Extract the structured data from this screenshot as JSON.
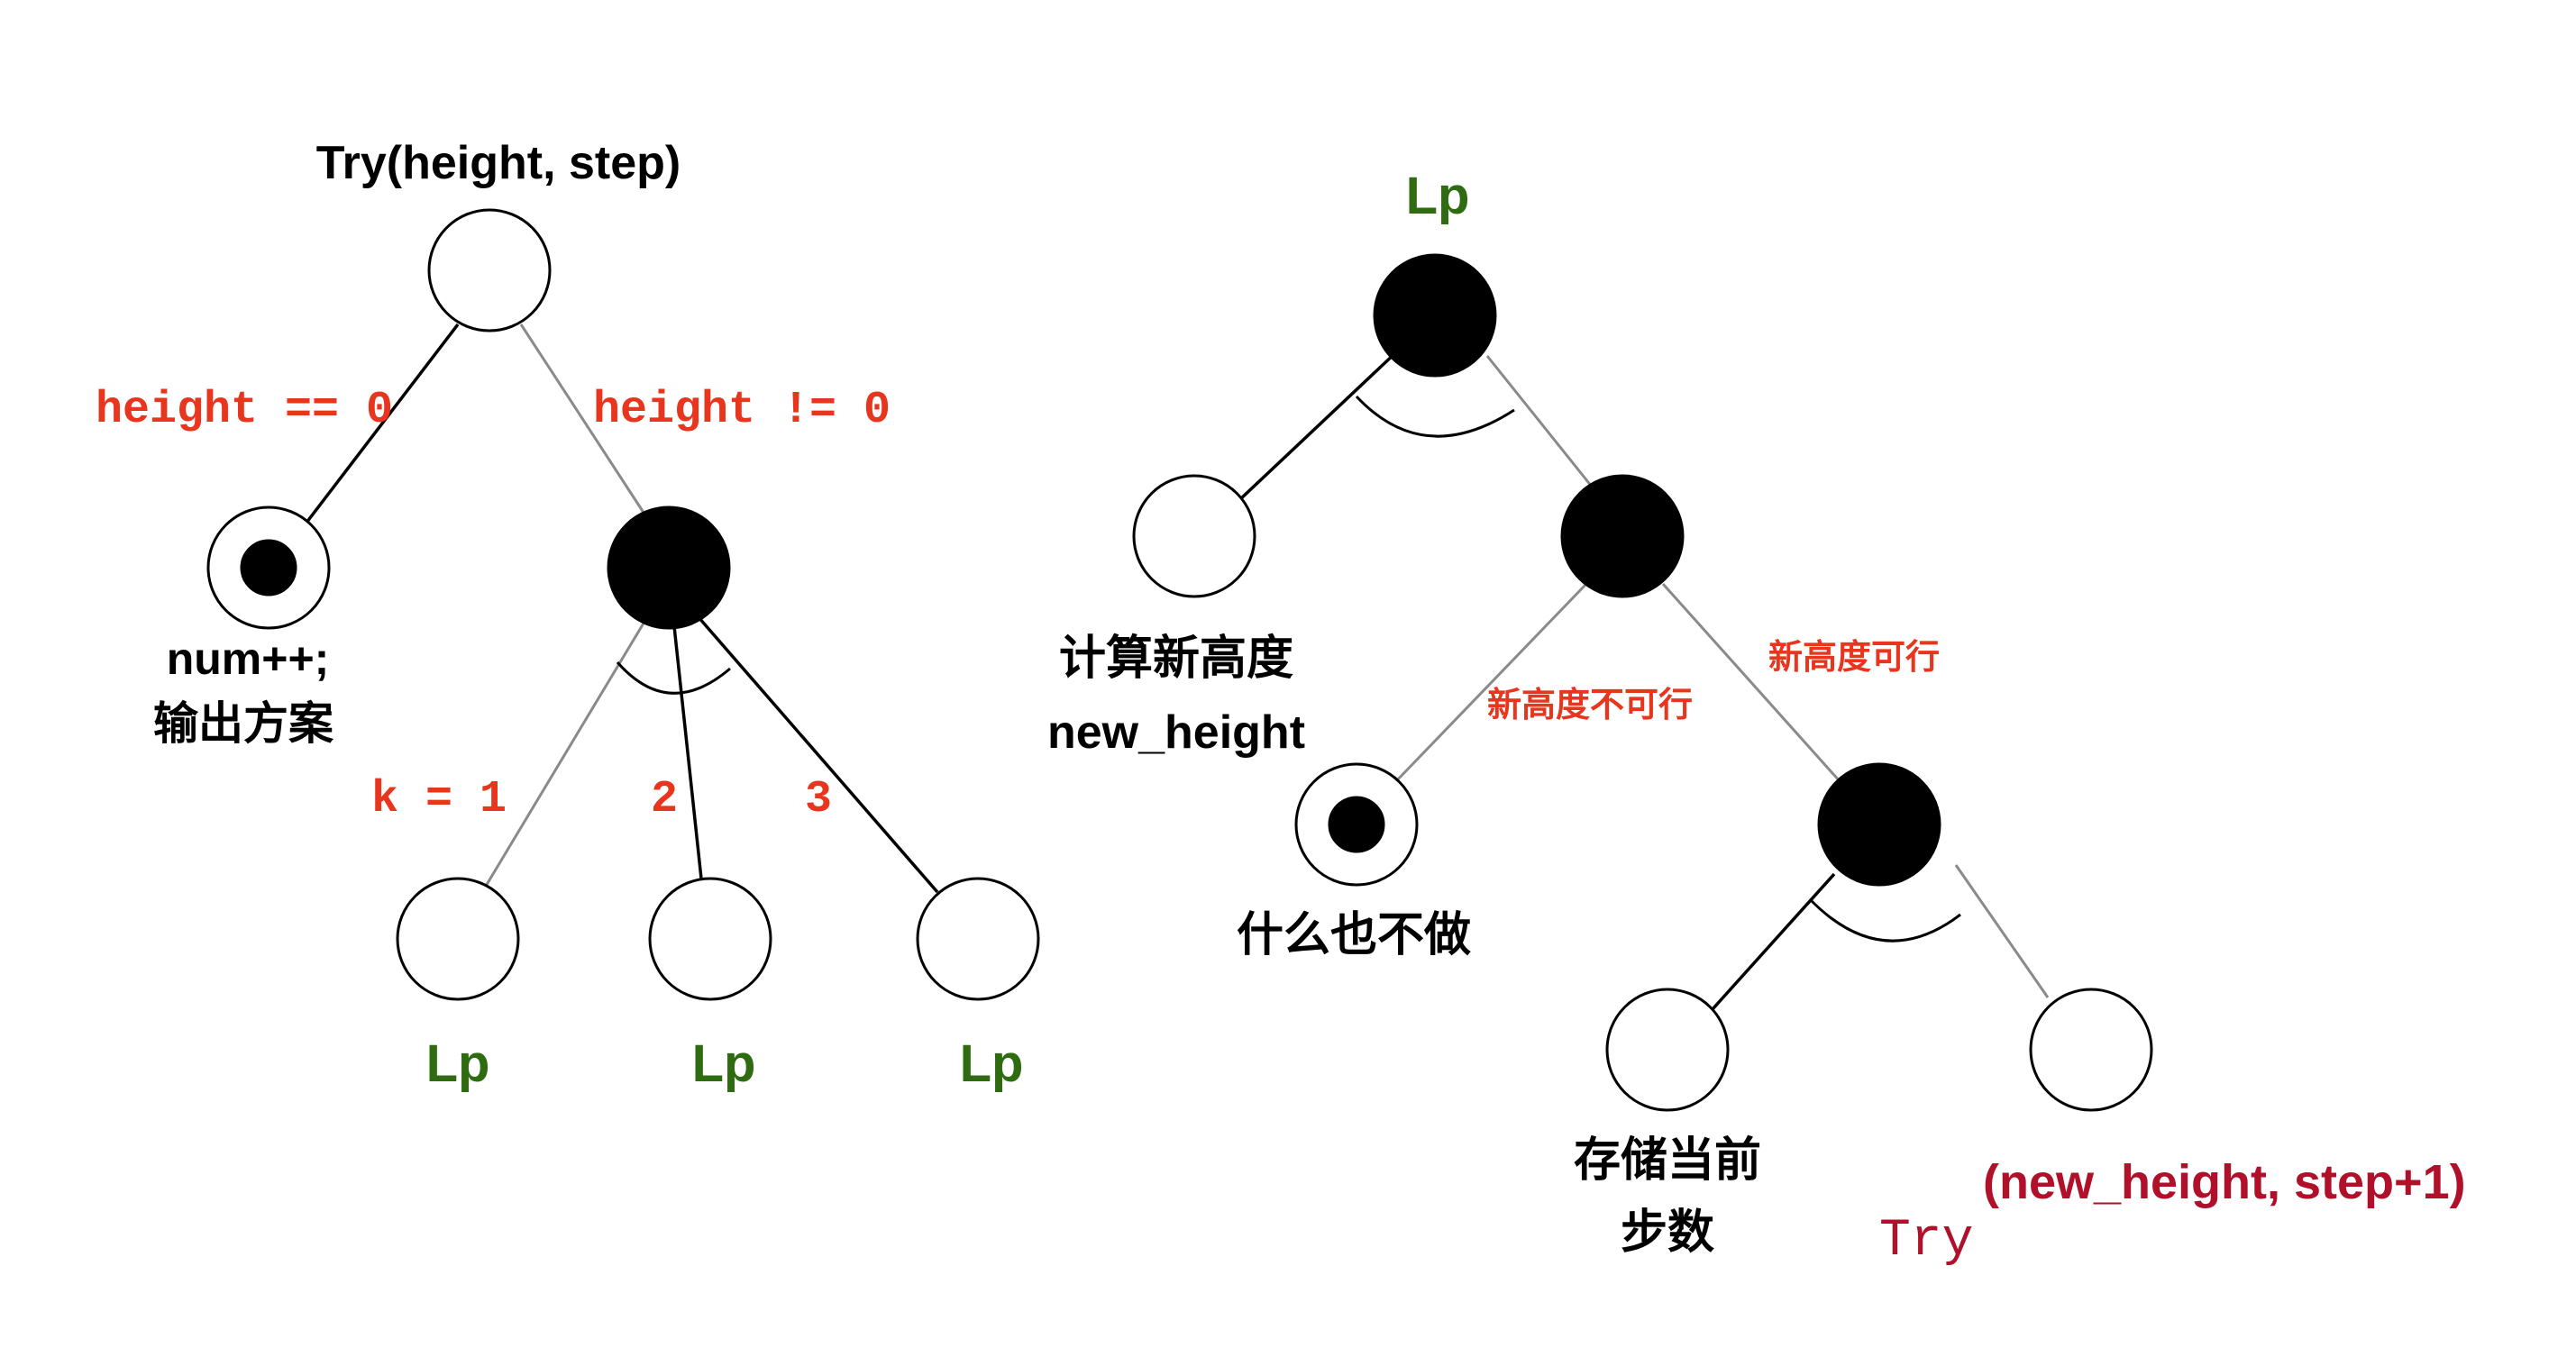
{
  "left_tree": {
    "root_label": "Try(height, step)",
    "edge_label_left": "height == 0",
    "edge_label_right": "height != 0",
    "leaf_label_line1": "num++;",
    "leaf_label_line2": "输出方案",
    "k_label_1": "k = 1",
    "k_label_2": "2",
    "k_label_3": "3",
    "child_label_1": "Lp",
    "child_label_2": "Lp",
    "child_label_3": "Lp"
  },
  "right_tree": {
    "root_label": "Lp",
    "compute_label_line1": "计算新高度",
    "compute_label_line2": "new_height",
    "infeasible_label": "新高度不可行",
    "feasible_label": "新高度可行",
    "noop_label": "什么也不做",
    "store_label_line1": "存储当前",
    "store_label_line2": "步数",
    "try_prefix": "Try",
    "try_args": "(new_height, step+1)"
  },
  "colors": {
    "code_red": "#e8361e",
    "lp_green": "#2f6b10",
    "try_darkred": "#b0102a",
    "gray_edge": "#8a8a8a"
  }
}
